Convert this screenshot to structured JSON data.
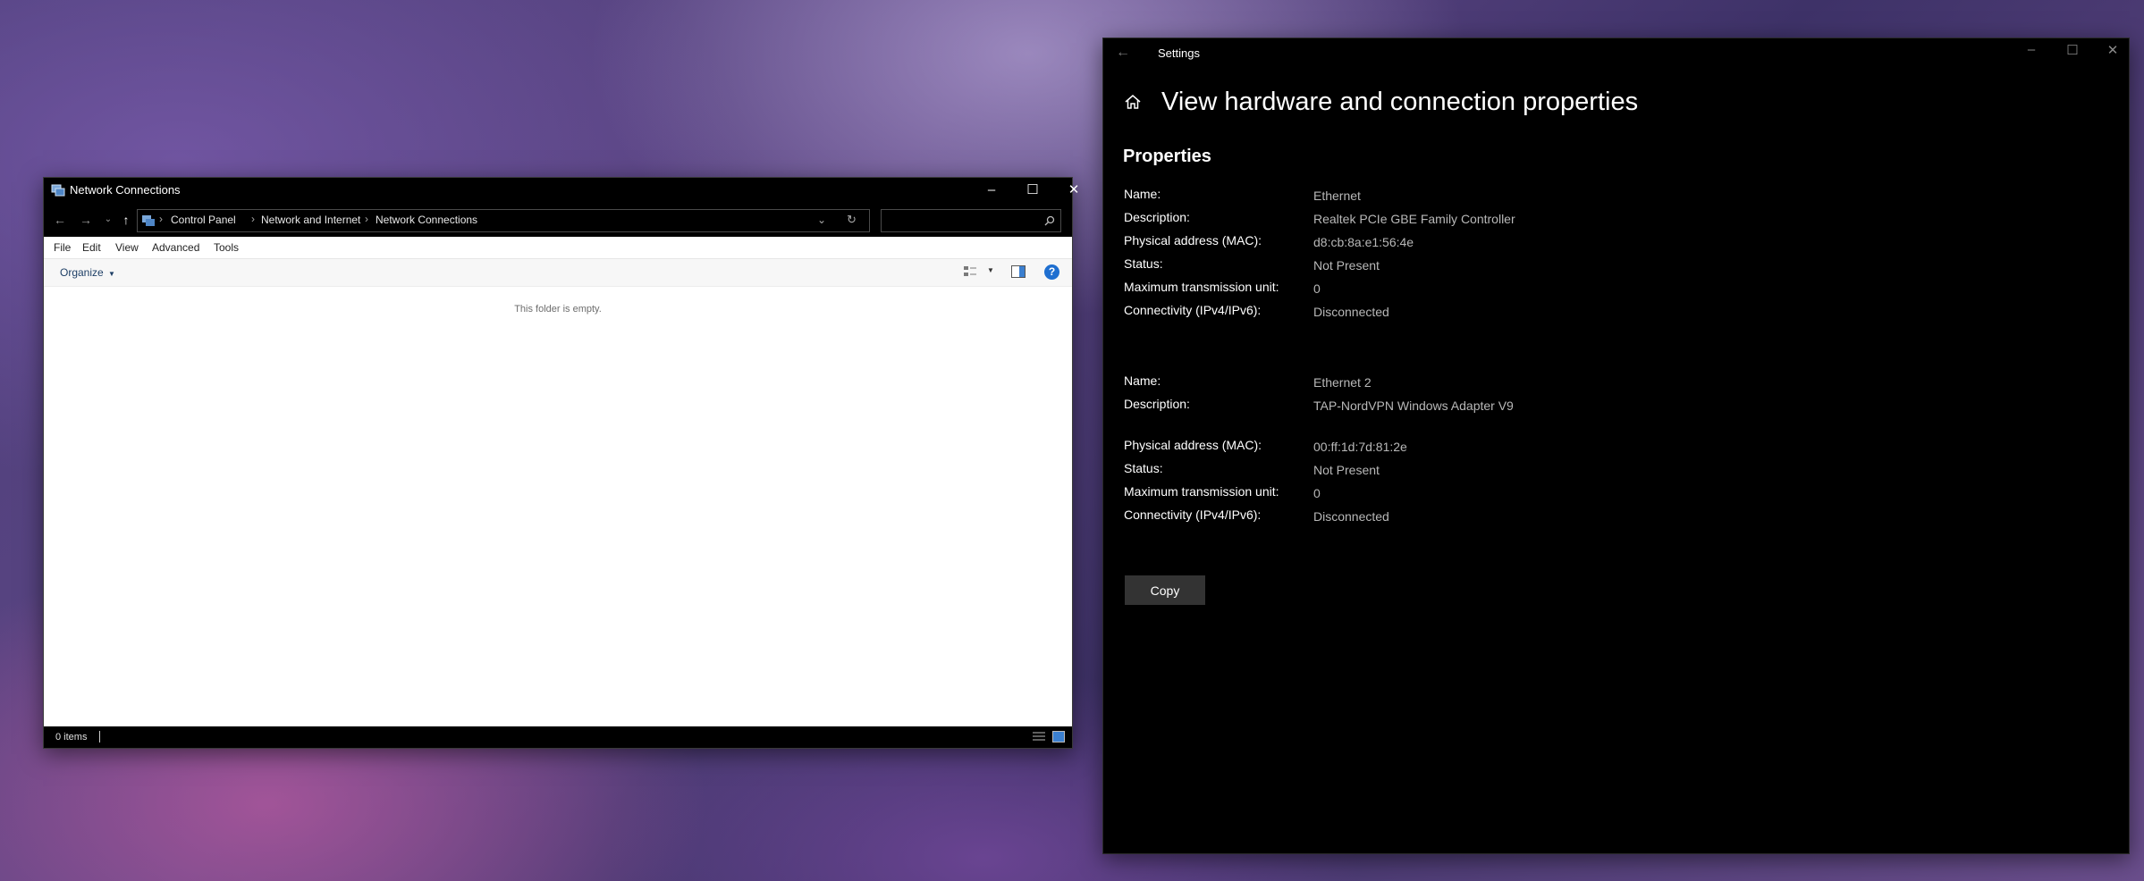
{
  "explorer": {
    "title": "Network Connections",
    "breadcrumbs": [
      "Control Panel",
      "Network and Internet",
      "Network Connections"
    ],
    "menu": [
      "File",
      "Edit",
      "View",
      "Advanced",
      "Tools"
    ],
    "organize_label": "Organize",
    "empty_text": "This folder is empty.",
    "status_items": "0 items"
  },
  "settings": {
    "app_title": "Settings",
    "page_title": "View hardware and connection properties",
    "section_title": "Properties",
    "adapters": [
      {
        "name_label": "Name:",
        "name": "Ethernet",
        "description_label": "Description:",
        "description": "Realtek PCIe GBE Family Controller",
        "mac_label": "Physical address (MAC):",
        "mac": "d8:cb:8a:e1:56:4e",
        "status_label": "Status:",
        "status": "Not Present",
        "mtu_label": "Maximum transmission unit:",
        "mtu": "0",
        "connectivity_label": "Connectivity (IPv4/IPv6):",
        "connectivity": "Disconnected"
      },
      {
        "name_label": "Name:",
        "name": "Ethernet 2",
        "description_label": "Description:",
        "description": "TAP-NordVPN Windows Adapter V9",
        "mac_label": "Physical address (MAC):",
        "mac": "00:ff:1d:7d:81:2e",
        "status_label": "Status:",
        "status": "Not Present",
        "mtu_label": "Maximum transmission unit:",
        "mtu": "0",
        "connectivity_label": "Connectivity (IPv4/IPv6):",
        "connectivity": "Disconnected"
      }
    ],
    "copy_label": "Copy"
  }
}
